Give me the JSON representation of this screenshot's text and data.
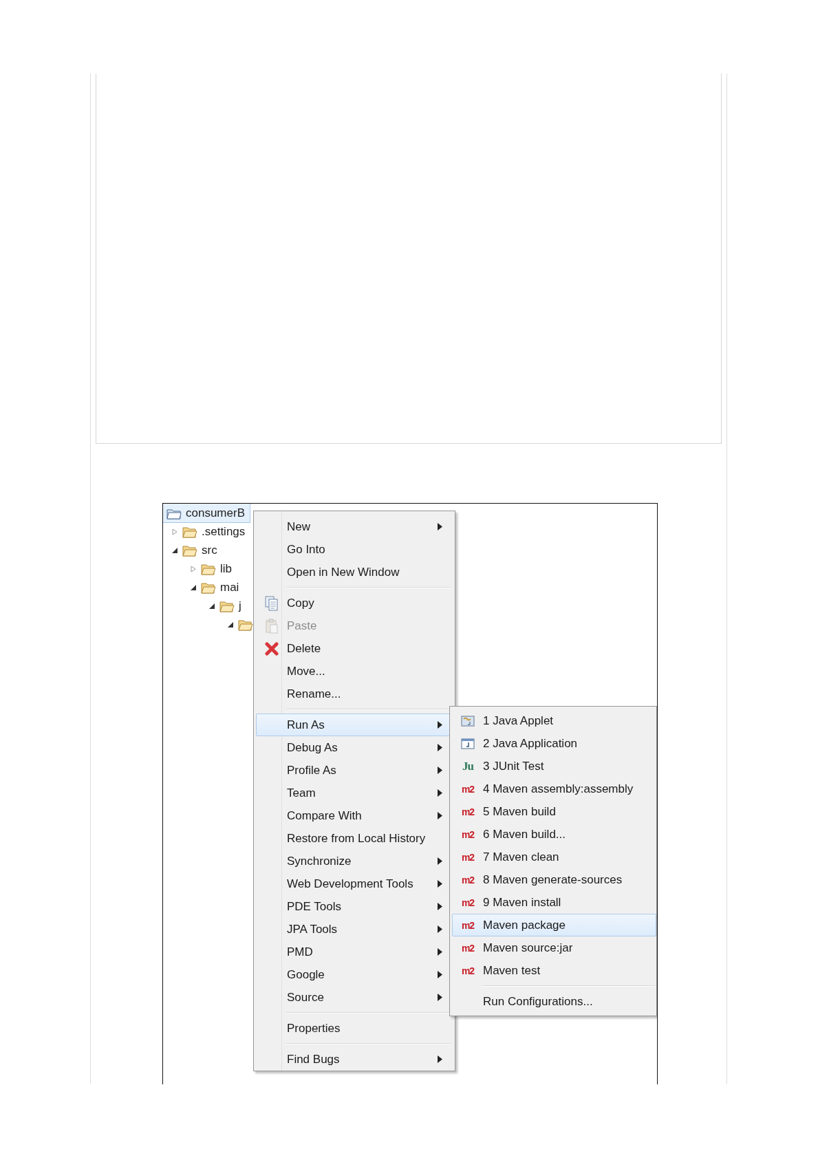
{
  "tree": {
    "label": "consumerB",
    "selected": true,
    "children": [
      {
        "label": ".settings",
        "selected": false,
        "expanded": false
      },
      {
        "label": "src",
        "selected": false,
        "expanded": true,
        "children": [
          {
            "label": "lib",
            "selected": false,
            "expanded": false
          },
          {
            "label": "mai",
            "selected": false,
            "expanded": true,
            "children": [
              {
                "label": "j",
                "selected": false,
                "expanded": true,
                "children": [
                  {
                    "selected": false,
                    "expanded": true
                  }
                ]
              }
            ]
          }
        ]
      }
    ]
  },
  "context_menu": {
    "sections": [
      [
        {
          "label": "New",
          "kind": "plain",
          "submenu": true,
          "disabled": false,
          "selected": false
        },
        {
          "label": "Go Into",
          "kind": "plain",
          "submenu": false,
          "disabled": false,
          "selected": false
        },
        {
          "label": "Open in New Window",
          "kind": "plain",
          "submenu": false,
          "disabled": false,
          "selected": false
        }
      ],
      [
        {
          "label": "Copy",
          "kind": "copy",
          "submenu": false,
          "disabled": false,
          "selected": false
        },
        {
          "label": "Paste",
          "kind": "paste",
          "submenu": false,
          "disabled": true,
          "selected": false
        },
        {
          "label": "Delete",
          "kind": "delete",
          "submenu": false,
          "disabled": false,
          "selected": false
        },
        {
          "label": "Move...",
          "kind": "plain",
          "submenu": false,
          "disabled": false,
          "selected": false
        },
        {
          "label": "Rename...",
          "kind": "plain",
          "submenu": false,
          "disabled": false,
          "selected": false
        }
      ],
      [
        {
          "label": "Run As",
          "kind": "plain",
          "submenu": true,
          "disabled": false,
          "selected": true
        },
        {
          "label": "Debug As",
          "kind": "plain",
          "submenu": true,
          "disabled": false,
          "selected": false
        },
        {
          "label": "Profile As",
          "kind": "plain",
          "submenu": true,
          "disabled": false,
          "selected": false
        },
        {
          "label": "Team",
          "kind": "plain",
          "submenu": true,
          "disabled": false,
          "selected": false
        },
        {
          "label": "Compare With",
          "kind": "plain",
          "submenu": true,
          "disabled": false,
          "selected": false
        },
        {
          "label": "Restore from Local History",
          "kind": "plain",
          "submenu": false,
          "disabled": false,
          "selected": false
        },
        {
          "label": "Synchronize",
          "kind": "plain",
          "submenu": true,
          "disabled": false,
          "selected": false
        },
        {
          "label": "Web Development Tools",
          "kind": "plain",
          "submenu": true,
          "disabled": false,
          "selected": false
        },
        {
          "label": "PDE Tools",
          "kind": "plain",
          "submenu": true,
          "disabled": false,
          "selected": false
        },
        {
          "label": "JPA Tools",
          "kind": "plain",
          "submenu": true,
          "disabled": false,
          "selected": false
        },
        {
          "label": "PMD",
          "kind": "plain",
          "submenu": true,
          "disabled": false,
          "selected": false
        },
        {
          "label": "Google",
          "kind": "plain",
          "submenu": true,
          "disabled": false,
          "selected": false
        },
        {
          "label": "Source",
          "kind": "plain",
          "submenu": true,
          "disabled": false,
          "selected": false
        }
      ],
      [
        {
          "label": "Properties",
          "kind": "plain",
          "submenu": false,
          "disabled": false,
          "selected": false
        }
      ],
      [
        {
          "label": "Find Bugs",
          "kind": "plain",
          "submenu": true,
          "disabled": false,
          "selected": false
        }
      ]
    ]
  },
  "run_as_submenu": {
    "sections": [
      [
        {
          "label": "1 Java Applet",
          "kind": "applet",
          "selected": false
        },
        {
          "label": "2 Java Application",
          "kind": "application",
          "selected": false
        },
        {
          "label": "3 JUnit Test",
          "kind": "badge",
          "badge": "Ju",
          "selected": false
        },
        {
          "label": "4 Maven assembly:assembly",
          "kind": "badge",
          "badge": "m2",
          "selected": false
        },
        {
          "label": "5 Maven build",
          "kind": "badge",
          "badge": "m2",
          "selected": false
        },
        {
          "label": "6 Maven build...",
          "kind": "badge",
          "badge": "m2",
          "selected": false
        },
        {
          "label": "7 Maven clean",
          "kind": "badge",
          "badge": "m2",
          "selected": false
        },
        {
          "label": "8 Maven generate-sources",
          "kind": "badge",
          "badge": "m2",
          "selected": false
        },
        {
          "label": "9 Maven install",
          "kind": "badge",
          "badge": "m2",
          "selected": false
        },
        {
          "label": "Maven package",
          "kind": "badge",
          "badge": "m2",
          "selected": true
        },
        {
          "label": "Maven source:jar",
          "kind": "badge",
          "badge": "m2",
          "selected": false
        },
        {
          "label": "Maven test",
          "kind": "badge",
          "badge": "m2",
          "selected": false
        }
      ],
      [
        {
          "label": "Run Configurations...",
          "kind": "plain",
          "selected": false
        }
      ]
    ]
  }
}
